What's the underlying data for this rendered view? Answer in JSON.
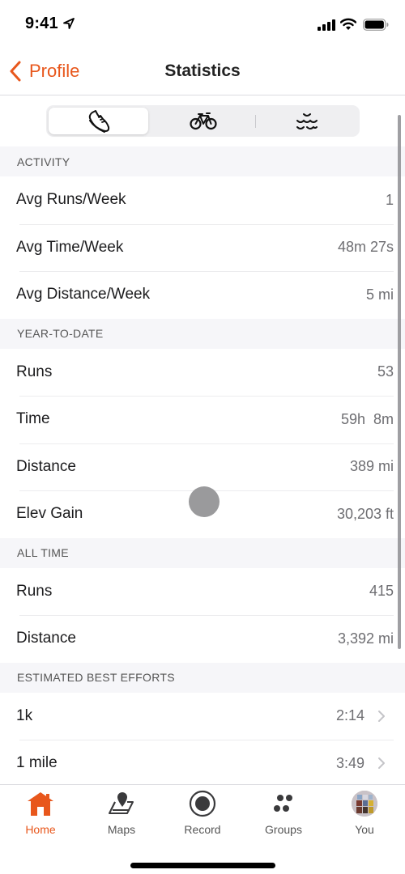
{
  "status_bar": {
    "time": "9:41",
    "icons": [
      "location-arrow-icon",
      "cellular-signal-icon",
      "wifi-icon",
      "battery-icon"
    ]
  },
  "nav": {
    "back_label": "Profile",
    "title": "Statistics"
  },
  "sport_selector": {
    "segments": [
      {
        "icon": "running-shoe-icon",
        "selected": true
      },
      {
        "icon": "bicycle-icon",
        "selected": false
      },
      {
        "icon": "swim-waves-icon",
        "selected": false
      }
    ]
  },
  "sections": [
    {
      "header": "ACTIVITY",
      "rows": [
        {
          "label": "Avg Runs/Week",
          "value": "1"
        },
        {
          "label": "Avg Time/Week",
          "value": "48m 27s"
        },
        {
          "label": "Avg Distance/Week",
          "value": "5 mi"
        }
      ]
    },
    {
      "header": "YEAR-TO-DATE",
      "rows": [
        {
          "label": "Runs",
          "value": "53"
        },
        {
          "label": "Time",
          "value": "59h  8m"
        },
        {
          "label": "Distance",
          "value": "389 mi"
        },
        {
          "label": "Elev Gain",
          "value": "30,203 ft"
        }
      ]
    },
    {
      "header": "ALL TIME",
      "rows": [
        {
          "label": "Runs",
          "value": "415"
        },
        {
          "label": "Distance",
          "value": "3,392 mi"
        }
      ]
    },
    {
      "header": "ESTIMATED BEST EFFORTS",
      "rows": [
        {
          "label": "1k",
          "value": "2:14",
          "has_chevron": true
        },
        {
          "label": "1 mile",
          "value": "3:49",
          "has_chevron": true
        }
      ]
    }
  ],
  "tab_bar": {
    "tabs": [
      {
        "label": "Home",
        "icon": "home-icon",
        "active": true
      },
      {
        "label": "Maps",
        "icon": "map-pin-icon",
        "active": false
      },
      {
        "label": "Record",
        "icon": "record-icon",
        "active": false
      },
      {
        "label": "Groups",
        "icon": "groups-icon",
        "active": false
      },
      {
        "label": "You",
        "icon": "avatar",
        "active": false
      }
    ]
  },
  "colors": {
    "accent": "#e8571c",
    "section_bg": "#f6f6f9",
    "value_text": "#6e6e72"
  }
}
